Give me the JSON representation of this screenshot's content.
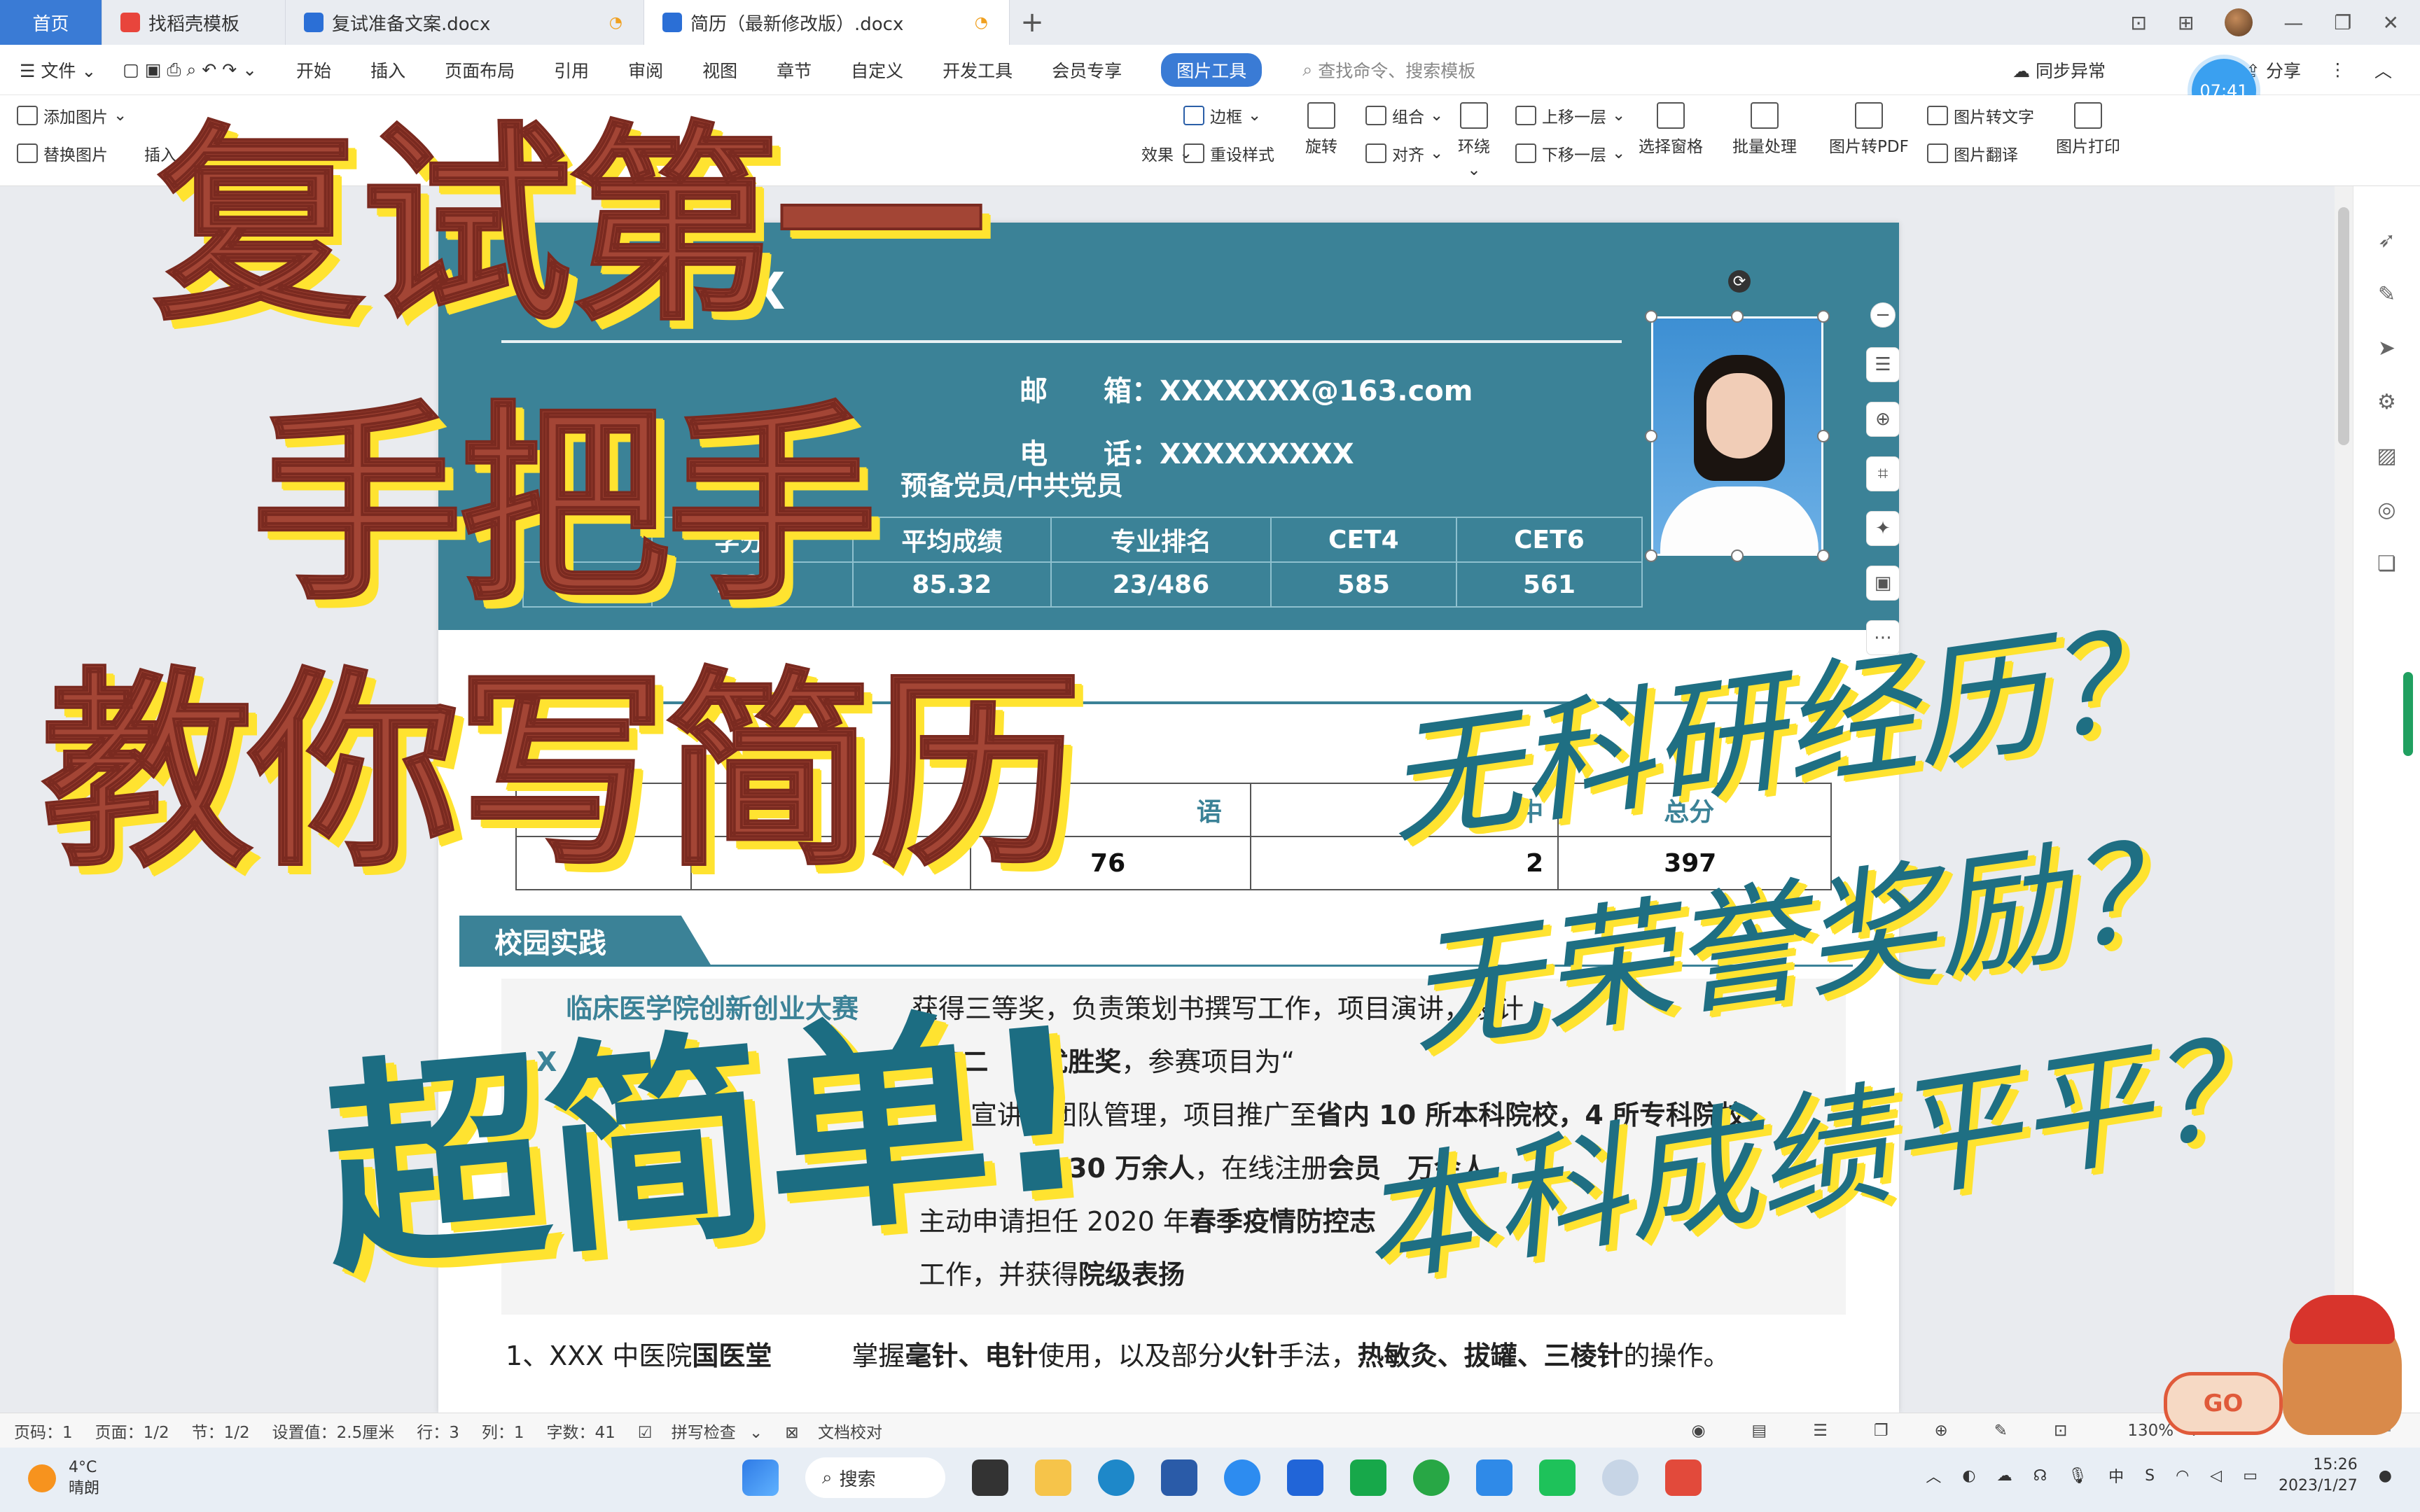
{
  "tabs": [
    {
      "label": "首页",
      "active": false
    },
    {
      "label": "找稻壳模板",
      "active": false
    },
    {
      "label": "复试准备文案.docx",
      "active": false
    },
    {
      "label": "简历（最新修改版）.docx",
      "active": true
    }
  ],
  "menu": {
    "file": "文件",
    "items": [
      "开始",
      "插入",
      "页面布局",
      "引用",
      "审阅",
      "视图",
      "章节",
      "自定义",
      "开发工具",
      "会员专享"
    ],
    "picture_tools": "图片工具",
    "search_placeholder": "查找命令、搜索模板",
    "sync": "同步异常",
    "share": "分享",
    "clock": "07:41"
  },
  "ribbon": {
    "add_picture": "添加图片",
    "replace_picture": "替换图片",
    "insert": "插入",
    "border": "边框",
    "effect": "效果",
    "reset_style": "重设样式",
    "rotate": "旋转",
    "group": "组合",
    "align": "对齐",
    "wrap": "环绕",
    "bring_forward": "上移一层",
    "send_backward": "下移一层",
    "selection_pane": "选择窗格",
    "batch": "批量处理",
    "to_pdf": "图片转PDF",
    "to_text": "图片转文字",
    "translate": "图片翻译",
    "print": "图片打印"
  },
  "resume": {
    "name": "X",
    "email_label": "邮　　箱：",
    "email": "XXXXXXX@163.com",
    "phone_label": "电　　话：",
    "phone": "XXXXXXXXX",
    "party": "预备党员/中共党员",
    "score_headers": [
      "",
      "学分绩",
      "平均成绩",
      "专业排名",
      "CET4",
      "CET6"
    ],
    "score_values": [
      "",
      "3.29/",
      "85.32",
      "23/486",
      "585",
      "561"
    ],
    "exam_headers": [
      "",
      "",
      "语",
      "中",
      "总分"
    ],
    "exam_values": [
      "",
      "",
      "76",
      "2",
      "397"
    ],
    "section_practice": "校园实践",
    "practice_line1_title": "临床医学院创新创业大赛",
    "practice_line1_text": "获得三等奖，负责策划书撰写工作，项目演讲，设计",
    "practice_line2_prefix": "X",
    "practice_line2_a": "校二",
    "practice_line2_b": "市优胜奖",
    "practice_line2_c": "，参赛项目为“",
    "practice_line3_a": "宣",
    "practice_line3_b": "讲、团队管理，项目推广至",
    "practice_line3_c": "省内 10 所本科院校，4 所专科院校",
    "practice_line4_a": "30 万余人",
    "practice_line4_b": "，在线注册",
    "practice_line4_c": "会员",
    "practice_line4_d": "万余人。",
    "practice_line5": "主动申请担任 2020 年",
    "practice_line5_b": "春季疫情防控志",
    "practice_line6_a": "工作，并获得",
    "practice_line6_b": "院级表扬",
    "skill_line": "1、XXX 中医院",
    "skill_bold1": "国医堂",
    "skill_text": "掌握",
    "skill_bold2": "毫针、电针",
    "skill_text2": "使用，以及部分",
    "skill_bold3": "火针",
    "skill_text3": "手法，",
    "skill_bold4": "热敏灸、拔罐、三棱针",
    "skill_text4": "的操作。"
  },
  "status": {
    "page": "页码：1",
    "pages": "页面：1/2",
    "section": "节：1/2",
    "setting": "设置值：2.5厘米",
    "row": "行：3",
    "col": "列：1",
    "words": "字数：41",
    "spell": "拼写检查",
    "proof": "文档校对",
    "zoom": "130%"
  },
  "taskbar": {
    "temp": "4°C",
    "weather": "晴朗",
    "search": "搜索",
    "time": "15:26",
    "date": "2023/1/27",
    "ime": "中"
  },
  "overlay": {
    "line1": "复试第一",
    "line2": "手把手",
    "line3": "教你写简历",
    "line4": "超简单!",
    "q1": "无科研经历？",
    "q2": "无荣誉奖励？",
    "q3": "本科成绩平平？"
  },
  "mascot_text": "GO"
}
